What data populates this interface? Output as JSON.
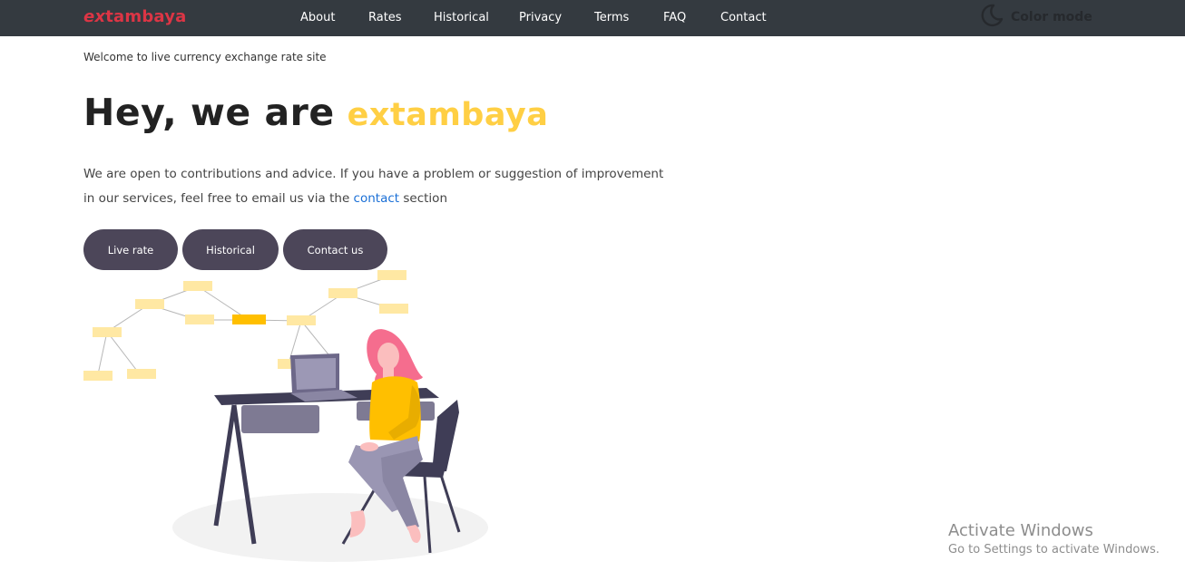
{
  "navbar": {
    "brand_prefix": "ex",
    "brand_suffix": "tambaya",
    "links": [
      {
        "label": "About"
      },
      {
        "label": "Rates"
      },
      {
        "label": "Historical"
      },
      {
        "label": "Privacy"
      },
      {
        "label": "Terms"
      },
      {
        "label": "FAQ"
      },
      {
        "label": "Contact"
      }
    ],
    "color_mode": {
      "label": "Color mode",
      "icon": "moon-icon"
    },
    "colors": {
      "background": "#343a40",
      "brand": "#dc3545"
    }
  },
  "main": {
    "welcome": "Welcome to live currency exchange rate site",
    "hero_prefix": "Hey, we are",
    "hero_brand": "extambaya",
    "description_before": "We are open to contributions and advice. If you have a problem or suggestion of improvement in our services, feel free to email us via the",
    "contact_link": "contact",
    "description_after": "section",
    "buttons": [
      {
        "label": "Live rate"
      },
      {
        "label": "Historical"
      },
      {
        "label": "Contact us"
      }
    ],
    "colors": {
      "accent": "#ffcf44",
      "button": "#4c4659",
      "link": "#1a6fd6"
    }
  },
  "watermark": {
    "title": "Activate Windows",
    "subtitle": "Go to Settings to activate Windows."
  }
}
